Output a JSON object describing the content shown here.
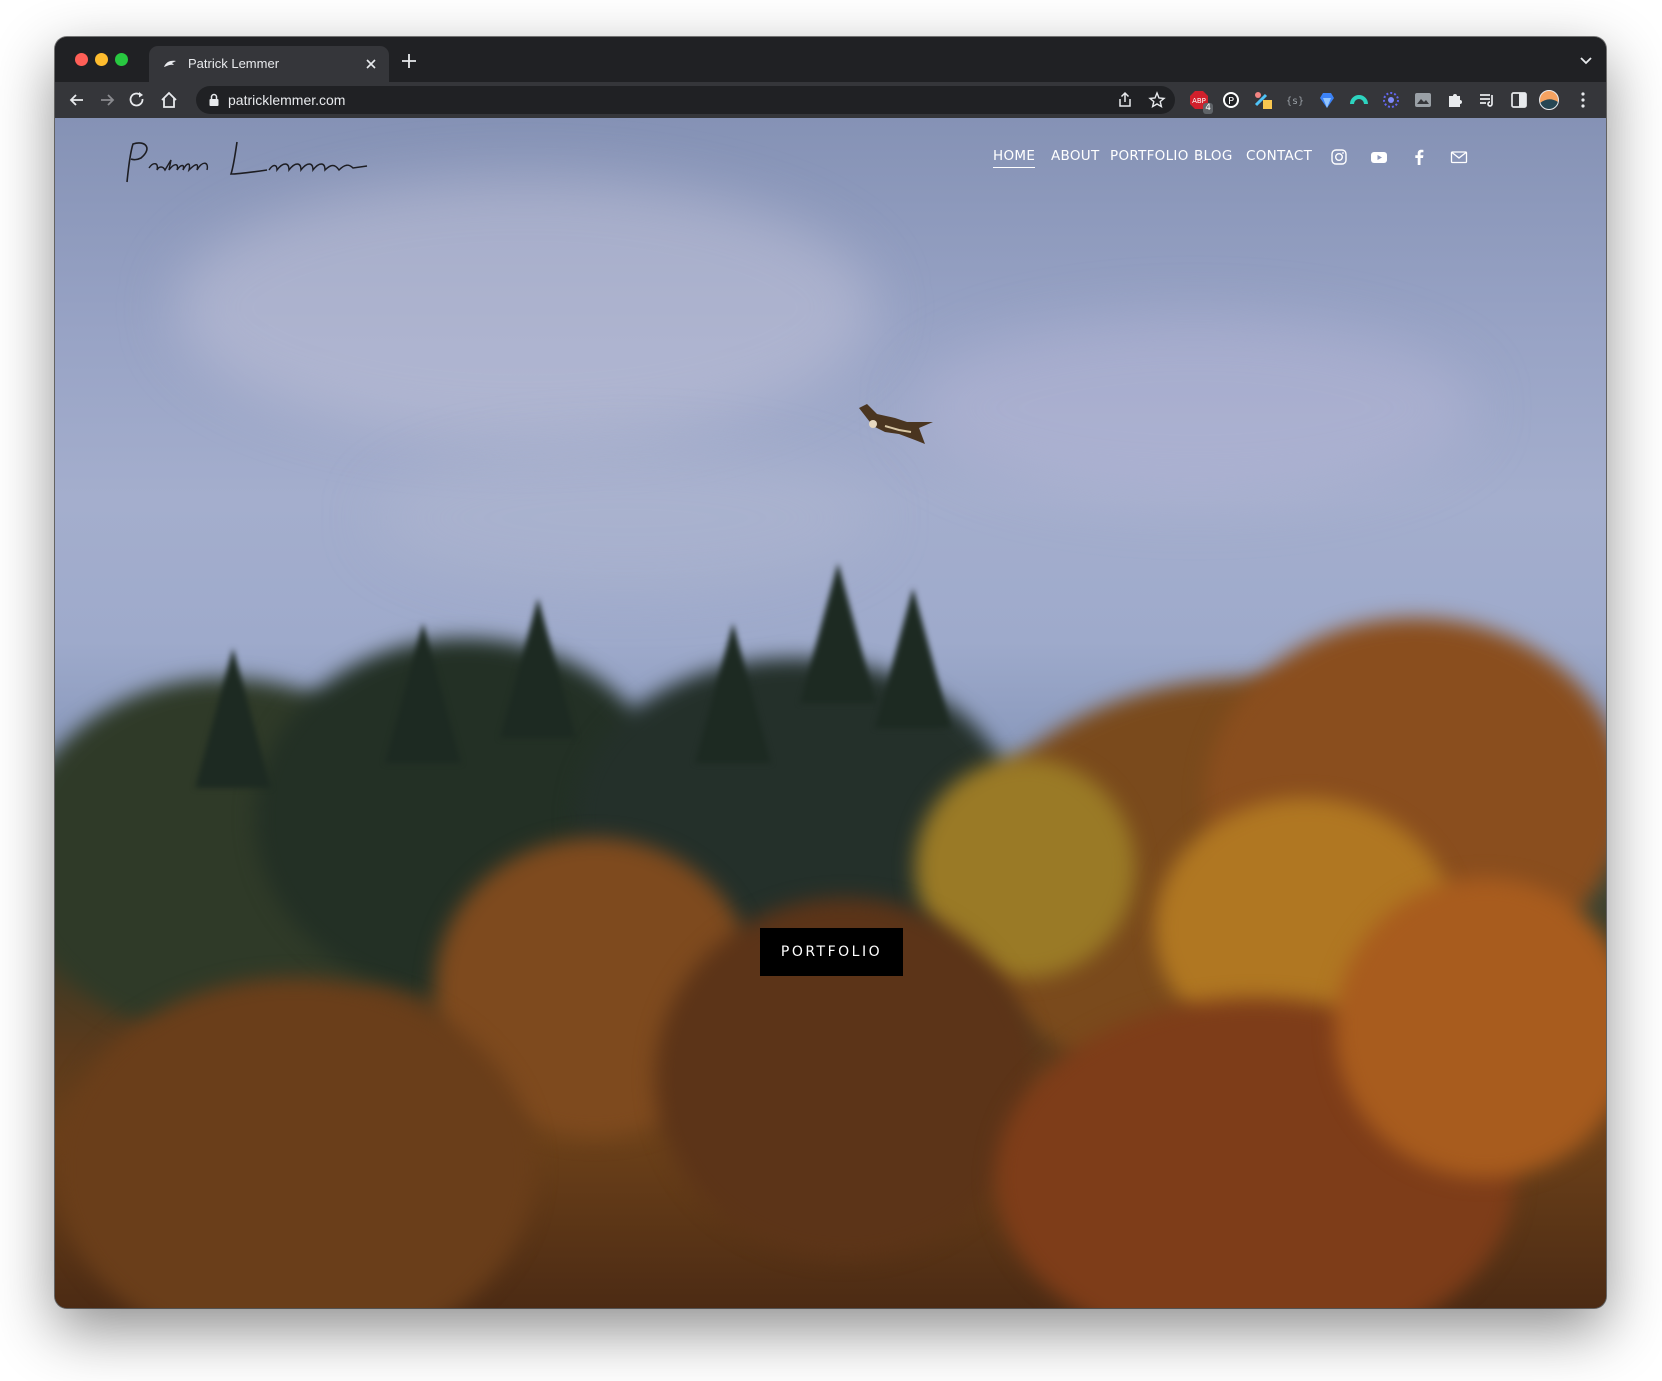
{
  "browser": {
    "tab": {
      "title": "Patrick Lemmer"
    },
    "address_bar": {
      "url": "patricklemmer.com"
    },
    "extensions": [
      "adblock-plus-icon",
      "pinterest-icon",
      "color-picker-icon",
      "code-icon",
      "diamond-icon",
      "speedometer-icon",
      "atom-icon",
      "image-icon",
      "puzzle-icon",
      "reading-list-icon",
      "side-panel-icon",
      "profile-avatar"
    ],
    "adblock_badge": "4"
  },
  "site": {
    "nav": [
      {
        "label": "HOME",
        "active": true
      },
      {
        "label": "ABOUT",
        "active": false
      },
      {
        "label": "PORTFOLIO",
        "active": false
      },
      {
        "label": "BLOG",
        "active": false
      },
      {
        "label": "CONTACT",
        "active": false
      }
    ],
    "social": [
      "instagram-icon",
      "youtube-icon",
      "facebook-icon",
      "email-icon"
    ],
    "hero": {
      "button_label": "PORTFOLIO"
    }
  },
  "colors": {
    "cta_background": "#000000",
    "nav_text": "#ffffff",
    "chrome_dark": "#202124",
    "chrome_toolbar": "#35363a"
  }
}
